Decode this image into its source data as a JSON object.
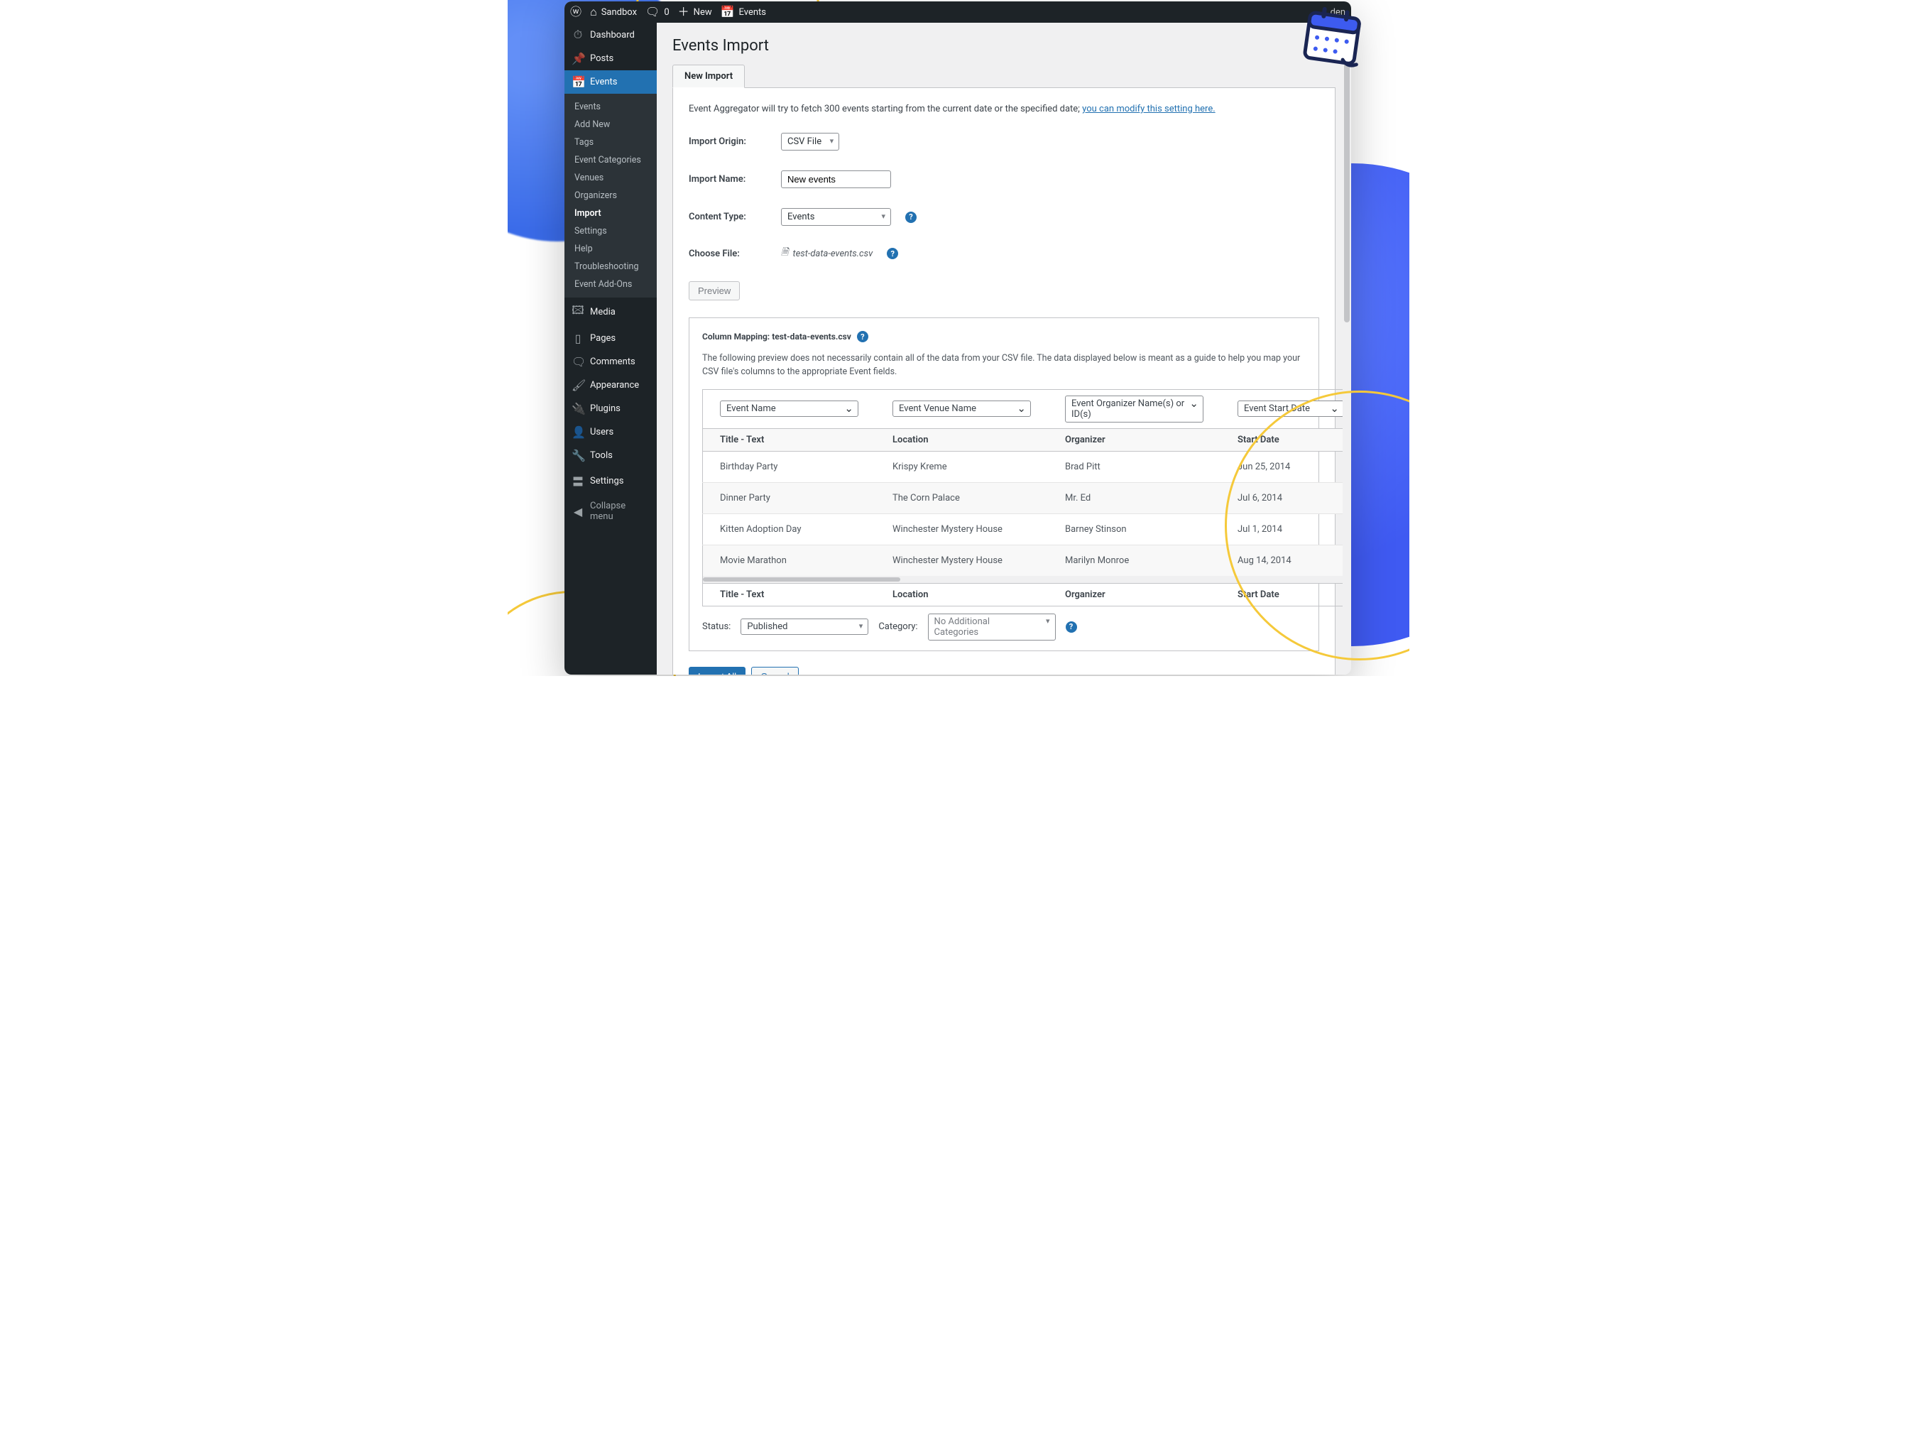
{
  "topbar": {
    "site_name": "Sandbox",
    "comments_count": "0",
    "new_label": "New",
    "events_label": "Events",
    "user": "den"
  },
  "sidebar": {
    "items": [
      {
        "label": "Dashboard"
      },
      {
        "label": "Posts"
      },
      {
        "label": "Events"
      },
      {
        "label": "Media"
      },
      {
        "label": "Pages"
      },
      {
        "label": "Comments"
      },
      {
        "label": "Appearance"
      },
      {
        "label": "Plugins"
      },
      {
        "label": "Users"
      },
      {
        "label": "Tools"
      },
      {
        "label": "Settings"
      }
    ],
    "events_sub": [
      {
        "label": "Events"
      },
      {
        "label": "Add New"
      },
      {
        "label": "Tags"
      },
      {
        "label": "Event Categories"
      },
      {
        "label": "Venues"
      },
      {
        "label": "Organizers"
      },
      {
        "label": "Import"
      },
      {
        "label": "Settings"
      },
      {
        "label": "Help"
      },
      {
        "label": "Troubleshooting"
      },
      {
        "label": "Event Add-Ons"
      }
    ],
    "collapse_label": "Collapse menu"
  },
  "page": {
    "title": "Events Import",
    "tab_label": "New Import",
    "intro_text": "Event Aggregator will try to fetch 300 events starting from the current date or the specified date; ",
    "intro_link": "you can modify this setting here.",
    "labels": {
      "origin": "Import Origin:",
      "name": "Import Name:",
      "content_type": "Content Type:",
      "choose_file": "Choose File:"
    },
    "values": {
      "origin": "CSV File",
      "name": "New events",
      "content_type": "Events",
      "filename": "test-data-events.csv"
    },
    "preview_button": "Preview"
  },
  "mapping": {
    "title_prefix": "Column Mapping: ",
    "title_file": "test-data-events.csv",
    "description": "The following preview does not necessarily contain all of the data from your CSV file. The data displayed below is meant as a guide to help you map your CSV file's columns to the appropriate Event fields.",
    "col_selects": [
      "Event Name",
      "Event Venue Name",
      "Event Organizer Name(s) or ID(s)",
      "Event Start Date"
    ],
    "headers": [
      "Title - Text",
      "Location",
      "Organizer",
      "Start Date"
    ],
    "rows": [
      {
        "title": "Birthday Party",
        "location": "Krispy Kreme",
        "organizer": "Brad Pitt",
        "date": "Jun 25, 2014"
      },
      {
        "title": "Dinner Party",
        "location": "The Corn Palace",
        "organizer": "Mr. Ed",
        "date": "Jul 6, 2014"
      },
      {
        "title": "Kitten Adoption Day",
        "location": "Winchester Mystery House",
        "organizer": "Barney Stinson",
        "date": "Jul 1, 2014"
      },
      {
        "title": "Movie Marathon",
        "location": "Winchester Mystery House",
        "organizer": "Marilyn Monroe",
        "date": "Aug 14, 2014"
      }
    ]
  },
  "meta": {
    "status_label": "Status:",
    "status_value": "Published",
    "category_label": "Category:",
    "category_value": "No Additional Categories"
  },
  "actions": {
    "import_all": "Import All",
    "cancel": "Cancel"
  }
}
